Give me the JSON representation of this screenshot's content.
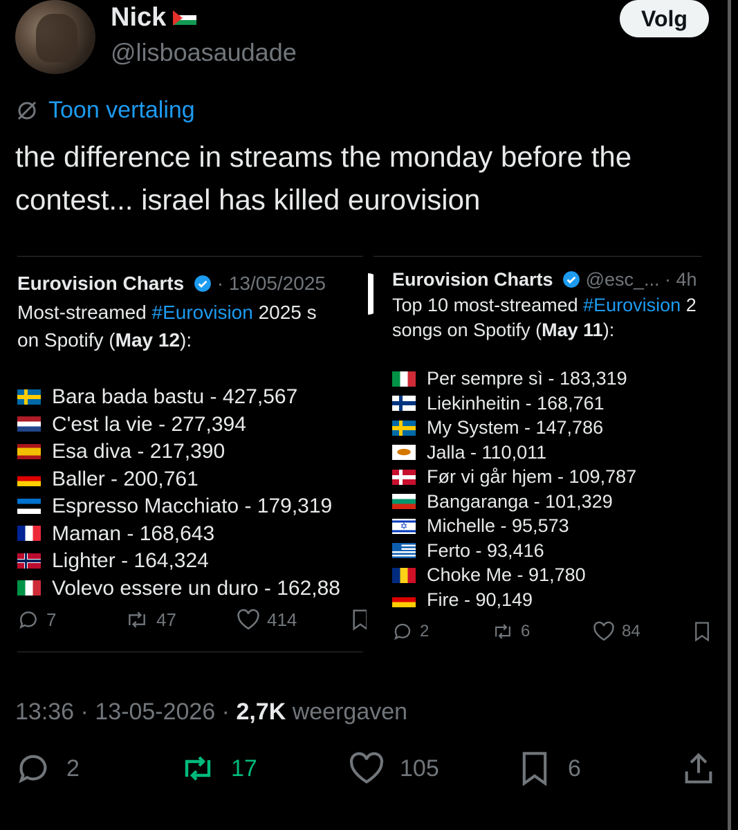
{
  "author": {
    "name": "Nick",
    "handle": "@lisboasaudade",
    "follow_label": "Volg"
  },
  "translate_label": "Toon vertaling",
  "tweet_text": "the difference in streams the monday before the contest... israel has killed eurovision",
  "embeds": [
    {
      "name": "Eurovision Charts",
      "meta": "· 13/05/2025",
      "line1_pre": "Most-streamed ",
      "hashtag": "#Eurovision",
      "line1_post": " 2025 s",
      "line2_pre": "on Spotify (",
      "line2_bold": "May 12",
      "line2_post": "):",
      "rows": [
        {
          "flag": "SE",
          "text": "Bara bada bastu - 427,567"
        },
        {
          "flag": "NL",
          "text": "C'est la vie - 277,394"
        },
        {
          "flag": "ES",
          "text": "Esa diva - 217,390"
        },
        {
          "flag": "DE",
          "text": "Baller - 200,761"
        },
        {
          "flag": "EE",
          "text": "Espresso Macchiato - 179,319"
        },
        {
          "flag": "FR",
          "text": "Maman - 168,643"
        },
        {
          "flag": "NO",
          "text": "Lighter - 164,324"
        },
        {
          "flag": "IT",
          "text": "Volevo essere un duro - 162,88"
        }
      ],
      "replies": "7",
      "reposts": "47",
      "likes": "414"
    },
    {
      "name": "Eurovision Charts",
      "meta": "@esc_... · 4h",
      "line1_pre": "Top 10 most-streamed ",
      "hashtag": "#Eurovision",
      "line1_post": " 2",
      "line2_pre": "songs on Spotify (",
      "line2_bold": "May 11",
      "line2_post": "):",
      "rows": [
        {
          "flag": "IT",
          "text": "Per sempre sì - 183,319"
        },
        {
          "flag": "FI",
          "text": "Liekinheitin - 168,761"
        },
        {
          "flag": "SE",
          "text": "My System - 147,786"
        },
        {
          "flag": "CY",
          "text": "Jalla - 110,011"
        },
        {
          "flag": "DK",
          "text": "Før vi går hjem - 109,787"
        },
        {
          "flag": "BG",
          "text": "Bangaranga - 101,329"
        },
        {
          "flag": "IL",
          "text": "Michelle - 95,573"
        },
        {
          "flag": "GR",
          "text": "Ferto - 93,416"
        },
        {
          "flag": "RO",
          "text": "Choke Me - 91,780"
        },
        {
          "flag": "DE",
          "text": "Fire - 90,149"
        }
      ],
      "replies": "2",
      "reposts": "6",
      "likes": "84"
    }
  ],
  "footer": {
    "time": "13:36 · 13-05-2026 · ",
    "views_count": "2,7K",
    "views_label": " weergaven"
  },
  "stats": {
    "replies": "2",
    "reposts": "17",
    "likes": "105",
    "bookmarks": "6"
  },
  "colors": {
    "background": "#000000",
    "text": "#e7e9ea",
    "muted": "#71767b",
    "accent": "#1d9bf0",
    "repost_active": "#00ba7c"
  }
}
